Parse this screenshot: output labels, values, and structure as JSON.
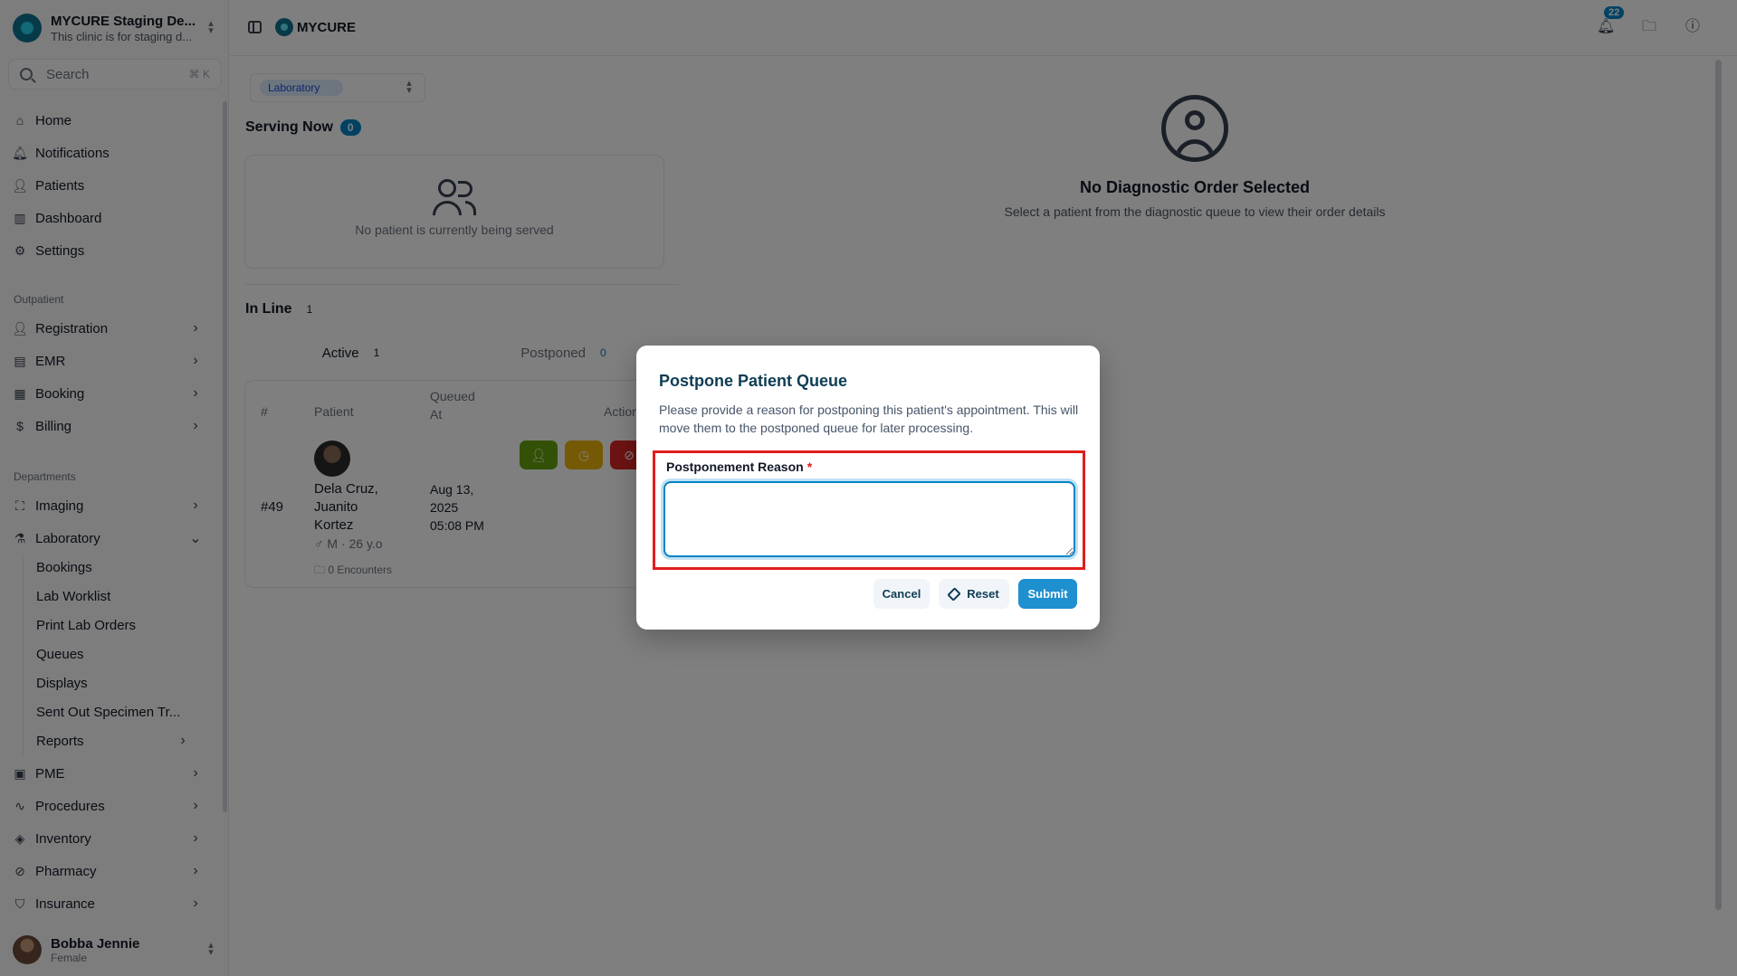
{
  "org": {
    "name": "MYCURE Staging De...",
    "subtitle": "This clinic is for staging d..."
  },
  "search": {
    "label": "Search",
    "shortcut": "⌘ K"
  },
  "nav_main": [
    {
      "label": "Home",
      "icon": "home-icon"
    },
    {
      "label": "Notifications",
      "icon": "bell-icon"
    },
    {
      "label": "Patients",
      "icon": "user-icon"
    },
    {
      "label": "Dashboard",
      "icon": "chart-icon"
    },
    {
      "label": "Settings",
      "icon": "gear-icon"
    }
  ],
  "groups": {
    "outpatient": "Outpatient",
    "departments": "Departments"
  },
  "nav_outpatient": [
    {
      "label": "Registration",
      "icon": "user-plus-icon"
    },
    {
      "label": "EMR",
      "icon": "file-icon"
    },
    {
      "label": "Booking",
      "icon": "calendar-icon"
    },
    {
      "label": "Billing",
      "icon": "dollar-icon"
    }
  ],
  "nav_departments": [
    {
      "label": "Imaging",
      "icon": "scan-icon"
    },
    {
      "label": "Laboratory",
      "icon": "flask-icon"
    }
  ],
  "laboratory_sub": [
    "Bookings",
    "Lab Worklist",
    "Print Lab Orders",
    "Queues",
    "Displays",
    "Sent Out Specimen Tr...",
    "Reports"
  ],
  "nav_more": [
    {
      "label": "PME",
      "icon": "clipboard-icon"
    },
    {
      "label": "Procedures",
      "icon": "activity-icon"
    },
    {
      "label": "Inventory",
      "icon": "box-icon"
    },
    {
      "label": "Pharmacy",
      "icon": "pill-icon"
    },
    {
      "label": "Insurance",
      "icon": "shield-icon"
    }
  ],
  "user": {
    "name": "Bobba Jennie",
    "subtitle": "Female"
  },
  "topbar": {
    "brand": "MYCURE",
    "notification_count": "22"
  },
  "department_select": "Laboratory",
  "serving_now": {
    "title": "Serving Now",
    "count": "0",
    "empty": "No patient is currently being served"
  },
  "in_line": {
    "title": "In Line",
    "count": "1"
  },
  "tabs": [
    {
      "label": "Active",
      "count": "1"
    },
    {
      "label": "Postponed",
      "count": "0"
    }
  ],
  "table": {
    "headers": {
      "num": "#",
      "patient": "Patient",
      "queued_l1": "Queued",
      "queued_l2": "At",
      "action": "Action"
    },
    "row": {
      "num": "#49",
      "name_l1": "Dela Cruz,",
      "name_l2": "Juanito",
      "name_l3": "Kortez",
      "sex_age": "♂ M · 26 y.o",
      "encounters": "🗀 0 Encounters",
      "queued_l1": "Aug 13,",
      "queued_l2": "2025",
      "queued_l3": "05:08 PM"
    }
  },
  "empty_order": {
    "title": "No Diagnostic Order Selected",
    "subtitle": "Select a patient from the diagnostic queue to view their order details"
  },
  "modal": {
    "title": "Postpone Patient Queue",
    "description": "Please provide a reason for postponing this patient's appointment. This will move them to the postponed queue for later processing.",
    "field_label": "Postponement Reason",
    "required_mark": "*",
    "field_value": "",
    "cancel": "Cancel",
    "reset": "Reset",
    "submit": "Submit"
  },
  "colors": {
    "accent": "#0284c7",
    "submit": "#1e8fcf",
    "highlight": "#e11d1d",
    "overlay": "rgba(0,0,0,0.5)"
  }
}
